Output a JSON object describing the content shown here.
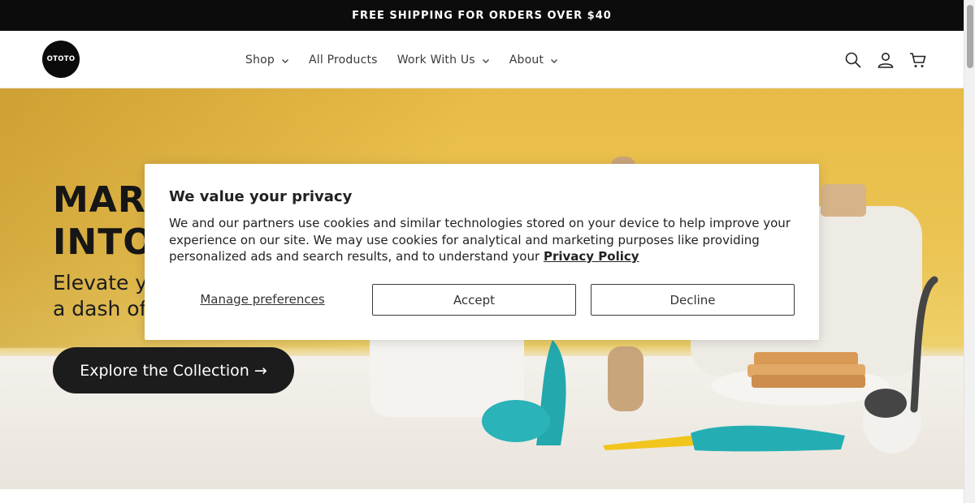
{
  "announcement": {
    "text": "FREE SHIPPING FOR ORDERS OVER $40"
  },
  "header": {
    "logo_text": "OTOTO",
    "nav": [
      {
        "label": "Shop",
        "has_dropdown": true
      },
      {
        "label": "All Products",
        "has_dropdown": false
      },
      {
        "label": "Work With Us",
        "has_dropdown": true
      },
      {
        "label": "About",
        "has_dropdown": true
      }
    ],
    "icons": [
      "search-icon",
      "account-icon",
      "cart-icon"
    ]
  },
  "hero": {
    "title_line1": "MARC",
    "title_line2": "INTO",
    "subtitle_line1": "Elevate y",
    "subtitle_line2": "a dash of",
    "cta_label": "Explore the Collection →"
  },
  "cookie_modal": {
    "title": "We value your privacy",
    "body": "We and our partners use cookies and similar technologies stored on your device to help improve your experience on our site. We may use cookies for analytical and marketing purposes like providing personalized ads and search results, and to understand your",
    "policy_link": "Privacy Policy",
    "manage_label": "Manage preferences",
    "accept_label": "Accept",
    "decline_label": "Decline"
  },
  "colors": {
    "announce_bg": "#0c0c0c",
    "hero_yellow": "#ebc453",
    "cta_bg": "#1c1c1c",
    "teal": "#2aa7a8"
  }
}
